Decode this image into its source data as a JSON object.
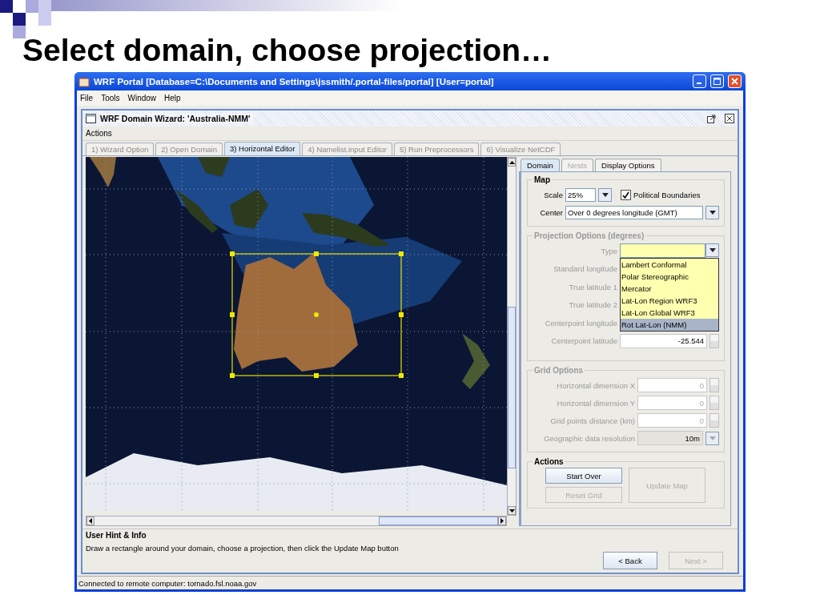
{
  "slide": {
    "title": "Select domain, choose projection…"
  },
  "window": {
    "title": "WRF Portal  [Database=C:\\Documents and Settings\\jssmith/.portal-files/portal]  [User=portal]",
    "menu": [
      "File",
      "Tools",
      "Window",
      "Help"
    ]
  },
  "wizard": {
    "title": "WRF Domain Wizard: 'Australia-NMM'",
    "menu": [
      "Actions"
    ],
    "steps": [
      {
        "label": "1) Wizard Option",
        "selected": false
      },
      {
        "label": "2) Open Domain",
        "selected": false
      },
      {
        "label": "3) Horizontal Editor",
        "selected": true
      },
      {
        "label": "4) Namelist.input Editor",
        "selected": false
      },
      {
        "label": "5) Run Preprocessors",
        "selected": false
      },
      {
        "label": "6) Visualize NetCDF",
        "selected": false
      }
    ]
  },
  "side_tabs": [
    {
      "label": "Domain",
      "selected": true,
      "disabled": false
    },
    {
      "label": "Nests",
      "selected": false,
      "disabled": true
    },
    {
      "label": "Display Options",
      "selected": false,
      "disabled": false
    }
  ],
  "map_options": {
    "title": "Map",
    "scale_label": "Scale",
    "scale": "25%",
    "political_boundaries": {
      "label": "Political Boundaries",
      "checked": true
    },
    "center_label": "Center",
    "center": "Over 0 degrees longitude (GMT)"
  },
  "projection": {
    "title": "Projection Options (degrees)",
    "disabled": true,
    "type_label": "Type",
    "fields": [
      {
        "label": "Standard longitude"
      },
      {
        "label": "True latitude 1"
      },
      {
        "label": "True latitude 2"
      },
      {
        "label": "Centerpoint longitude"
      },
      {
        "label": "Centerpoint latitude",
        "value": "-25.544"
      }
    ],
    "type_options": [
      {
        "label": "Lambert Conformal",
        "selected": false
      },
      {
        "label": "Polar Stereographic",
        "selected": false
      },
      {
        "label": "Mercator",
        "selected": false
      },
      {
        "label": "Lat-Lon Region WRF3",
        "selected": false
      },
      {
        "label": "Lat-Lon Global WRF3",
        "selected": false
      },
      {
        "label": "Rot Lat-Lon (NMM)",
        "selected": true
      }
    ]
  },
  "grid_options": {
    "title": "Grid Options",
    "disabled": true,
    "fields": [
      {
        "label": "Horizontal dimension X",
        "value": "0",
        "kind": "spinner"
      },
      {
        "label": "Horizontal dimension Y",
        "value": "0",
        "kind": "spinner"
      },
      {
        "label": "Grid points distance (km)",
        "value": "0",
        "kind": "spinner"
      },
      {
        "label": "Geographic data resolution",
        "value": "10m",
        "kind": "combo"
      }
    ]
  },
  "actions": {
    "title": "Actions",
    "buttons": [
      {
        "label": "Start Over",
        "disabled": false
      },
      {
        "label": "Reset Grid",
        "disabled": true
      },
      {
        "label": "Update Map",
        "disabled": true
      }
    ]
  },
  "hint": {
    "title": "User Hint & Info",
    "text": "Draw a rectangle around your domain, choose a projection, then click the Update Map button"
  },
  "nav_buttons": [
    {
      "label": "< Back",
      "disabled": false
    },
    {
      "label": "Next >",
      "disabled": true
    }
  ],
  "status_bar": "Connected to remote computer: tornado.fsl.noaa.gov"
}
